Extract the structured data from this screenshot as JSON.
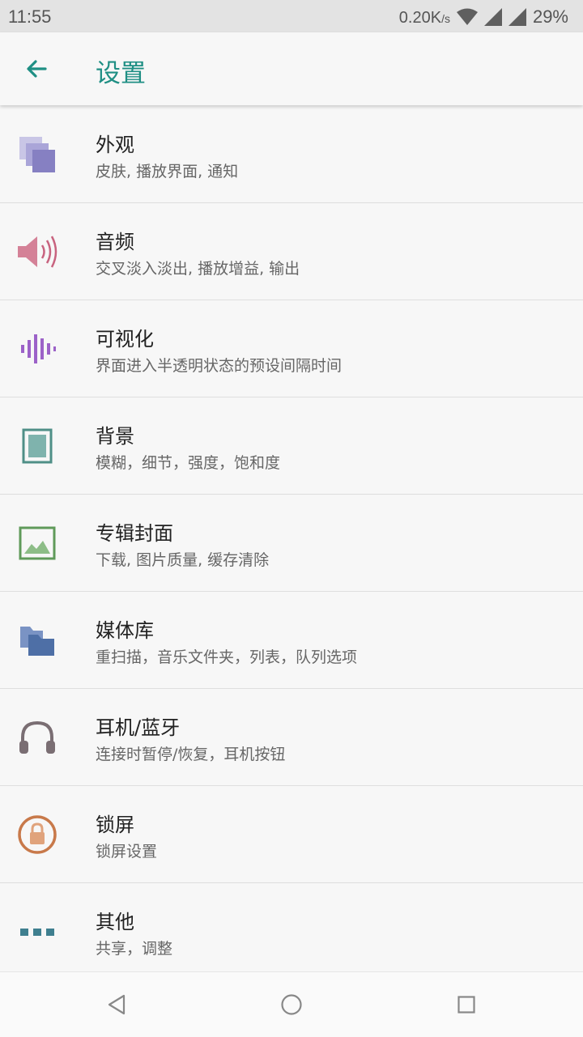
{
  "status_bar": {
    "time": "11:55",
    "net_speed": "0.20K",
    "net_speed_unit": "/s",
    "battery": "29%"
  },
  "app_bar": {
    "title": "设置",
    "back_icon": "arrow-back-icon"
  },
  "settings": [
    {
      "title": "外观",
      "subtitle": "皮肤, 播放界面, 通知",
      "icon": "layers-icon",
      "color": "#8e8ac4"
    },
    {
      "title": "音频",
      "subtitle": "交叉淡入淡出, 播放增益, 输出",
      "icon": "speaker-icon",
      "color": "#c8637f"
    },
    {
      "title": "可视化",
      "subtitle": "界面进入半透明状态的预设间隔时间",
      "icon": "visualizer-icon",
      "color": "#9c62c8"
    },
    {
      "title": "背景",
      "subtitle": "模糊，细节，强度，饱和度",
      "icon": "background-icon",
      "color": "#4f8f87"
    },
    {
      "title": "专辑封面",
      "subtitle": "下载, 图片质量, 缓存清除",
      "icon": "image-icon",
      "color": "#5f9a5a"
    },
    {
      "title": "媒体库",
      "subtitle": "重扫描，音乐文件夹，列表，队列选项",
      "icon": "folder-icon",
      "color": "#4e6fa6"
    },
    {
      "title": "耳机/蓝牙",
      "subtitle": "连接时暂停/恢复，耳机按钮",
      "icon": "headphones-icon",
      "color": "#7a6e73"
    },
    {
      "title": "锁屏",
      "subtitle": "锁屏设置",
      "icon": "lock-icon",
      "color": "#c8794a"
    },
    {
      "title": "其他",
      "subtitle": "共享，调整",
      "icon": "more-icon",
      "color": "#3f7f8f"
    }
  ],
  "nav_bar": {
    "back_icon": "nav-back-icon",
    "home_icon": "nav-home-icon",
    "recents_icon": "nav-recents-icon"
  }
}
